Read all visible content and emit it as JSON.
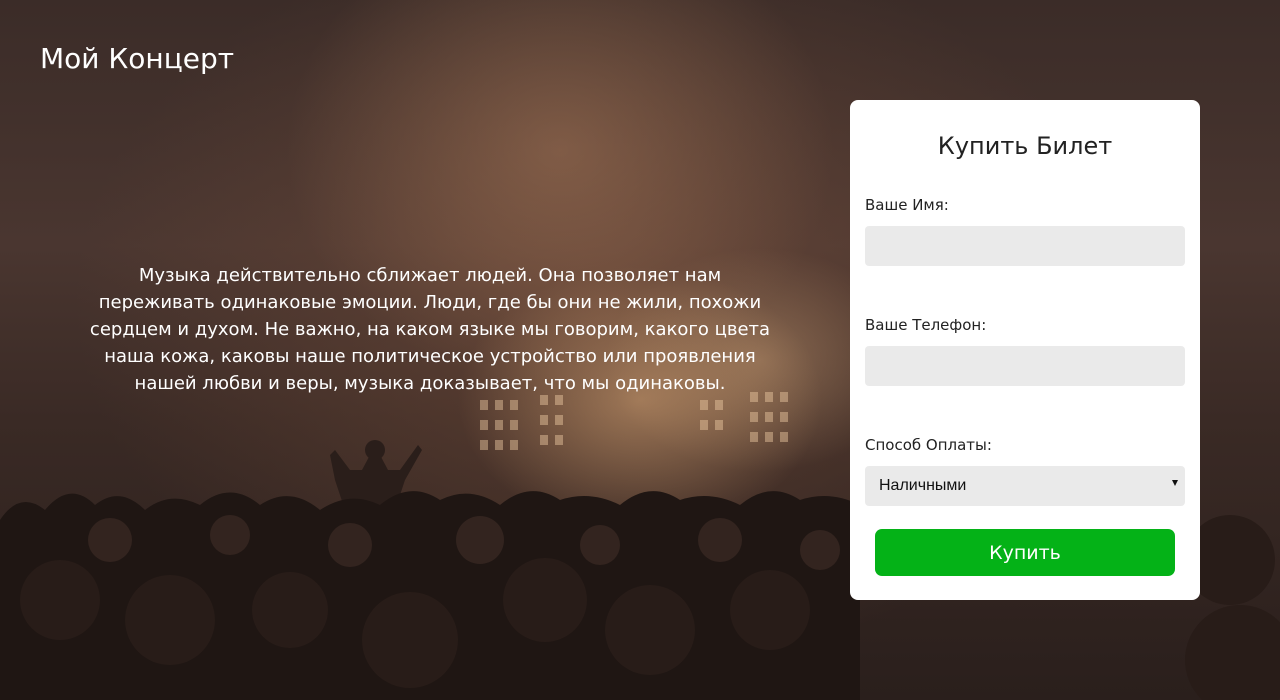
{
  "header": {
    "title": "Мой Концерт"
  },
  "hero": {
    "text": "Музыка действительно сближает людей. Она позволяет нам переживать одинаковые эмоции. Люди, где бы они не жили, похожи сердцем и духом. Не важно, на каком языке мы говорим, какого цвета наша кожа, каковы наше политическое устройство или проявления нашей любви и веры, музыка доказывает, что мы одинаковы."
  },
  "ticket_form": {
    "title": "Купить Билет",
    "name_label": "Ваше Имя:",
    "name_value": "",
    "phone_label": "Ваше Телефон:",
    "phone_value": "",
    "payment_label": "Способ Оплаты:",
    "payment_selected": "Наличными",
    "payment_icon": "chevron-down-icon",
    "submit_label": "Купить"
  },
  "colors": {
    "card_background": "#ffffff",
    "input_background": "#eaeaea",
    "button_green": "#04b217",
    "page_overlay": "#2a1f1c"
  }
}
